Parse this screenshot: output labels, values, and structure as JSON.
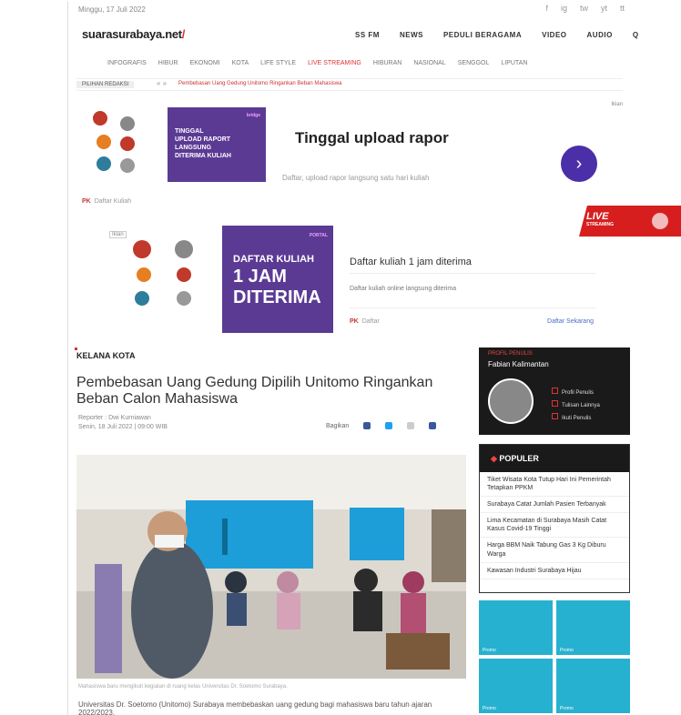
{
  "topbar": {
    "date": "Minggu, 17 Juli 2022",
    "social": [
      "f",
      "ig",
      "tw",
      "yt",
      "tt"
    ]
  },
  "logo": {
    "name": "suarasurabaya.net",
    "dot": "/"
  },
  "mainnav": [
    "SS FM",
    "NEWS",
    "PEDULI BERAGAMA",
    "VIDEO",
    "AUDIO",
    "Q"
  ],
  "subnav": [
    "INFOGRAFIS",
    "HIBUR",
    "EKONOMI",
    "KOTA",
    "LIFE STYLE",
    "LIVE STREAMING",
    "HIBURAN",
    "NASIONAL",
    "SENGGOL",
    "LIPUTAN"
  ],
  "ticker": {
    "label": "PILIHAN REDAKSI",
    "sep": "« »",
    "text": "Pembebasan Uang Gedung Unitomo Ringankan Beban Mahasiswa"
  },
  "ad1": {
    "mark": "Iklan",
    "purple_lines": [
      "TINGGAL",
      "UPLOAD RAPORT",
      "LANGSUNG",
      "DITERIMA KULIAH"
    ],
    "brand": "bridge",
    "title": "Tinggal upload rapor",
    "desc": "Daftar, upload rapor langsung satu hari kuliah",
    "foot_brand": "PK",
    "foot": "Daftar Kuliah"
  },
  "live": {
    "label": "LIVE",
    "sub": "STREAMING"
  },
  "ad2": {
    "mark": "Iklan",
    "brand": "PORTAL",
    "purple_top": "DAFTAR KULIAH",
    "purple_big": [
      "1 JAM",
      "DITERIMA"
    ],
    "title": "Daftar kuliah 1 jam diterima",
    "desc": "Daftar kuliah online langsung diterima",
    "foot_brand": "PK",
    "foot": "Daftar",
    "link": "Daftar Sekarang"
  },
  "article": {
    "kicker": "KELANA KOTA",
    "headline": "Pembebasan Uang Gedung Dipilih Unitomo Ringankan Beban Calon Mahasiswa",
    "author": "Reporter : Dwi Kurniawan",
    "date": "Senin, 18 Juli 2022 | 09:00 WIB",
    "share_label": "Bagikan",
    "caption": "Mahasiswa baru mengikuti kegiatan di ruang kelas Universitas Dr. Soetomo Surabaya.",
    "body": "Universitas Dr. Soetomo (Unitomo) Surabaya membebaskan uang gedung bagi mahasiswa baru tahun ajaran 2022/2023."
  },
  "sidebar": {
    "author_tag": "PROFIL PENULIS",
    "author_name": "Fabian Kalimantan",
    "author_links": [
      "Profil Penulis",
      "Tulisan Lainnya",
      "Ikuti Penulis"
    ],
    "popular_title": "POPULER",
    "popular_items": [
      "Tiket Wisata Kota Tutup Hari Ini Pemerintah Tetapkan PPKM",
      "Surabaya Catat Jumlah Pasien Terbanyak",
      "Lima Kecamatan di Surabaya Masih Catat Kasus Covid-19 Tinggi",
      "Harga BBM Naik Tabung Gas 3 Kg Diburu Warga",
      "Kawasan Industri Surabaya Hijau"
    ],
    "ad_labels": [
      "Promo",
      "Promo",
      "Promo",
      "Promo"
    ]
  },
  "colors": {
    "accent": "#d33",
    "purple": "#5b3a94",
    "dark": "#1a1a1a",
    "live": "#d71e1e"
  }
}
